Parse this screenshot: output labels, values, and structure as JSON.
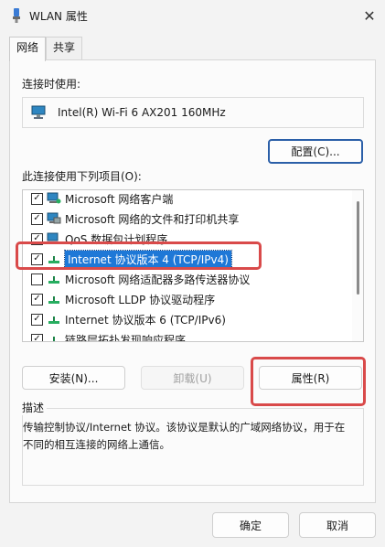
{
  "window": {
    "title": "WLAN 属性"
  },
  "tabs": [
    {
      "label": "网络"
    },
    {
      "label": "共享"
    }
  ],
  "connect_using": {
    "label": "连接时使用:",
    "adapter": "Intel(R) Wi-Fi 6 AX201 160MHz",
    "configure_button": "配置(C)..."
  },
  "items_section": {
    "label": "此连接使用下列项目(O):",
    "items": [
      {
        "label": "Microsoft 网络客户端",
        "checked": true,
        "icon": "network-client-icon"
      },
      {
        "label": "Microsoft 网络的文件和打印机共享",
        "checked": true,
        "icon": "file-print-share-icon"
      },
      {
        "label": "QoS 数据包计划程序",
        "checked": true,
        "icon": "qos-scheduler-icon"
      },
      {
        "label": "Internet 协议版本 4 (TCP/IPv4)",
        "checked": true,
        "selected": true,
        "icon": "protocol-icon"
      },
      {
        "label": "Microsoft 网络适配器多路传送器协议",
        "checked": false,
        "icon": "protocol-icon"
      },
      {
        "label": "Microsoft LLDP 协议驱动程序",
        "checked": true,
        "icon": "protocol-icon"
      },
      {
        "label": "Internet 协议版本 6 (TCP/IPv6)",
        "checked": true,
        "icon": "protocol-icon"
      },
      {
        "label": "链路层拓扑发现响应程序",
        "checked": true,
        "icon": "protocol-icon"
      }
    ]
  },
  "buttons": {
    "install": "安装(N)...",
    "uninstall": "卸载(U)",
    "properties": "属性(R)",
    "ok": "确定",
    "cancel": "取消"
  },
  "description": {
    "title": "描述",
    "text": "传输控制协议/Internet 协议。该协议是默认的广域网络协议，用于在不同的相互连接的网络上通信。"
  },
  "colors": {
    "highlight_box": "#d94a4a",
    "selection": "#1e78d7",
    "primary_border": "#2b5fa8"
  }
}
